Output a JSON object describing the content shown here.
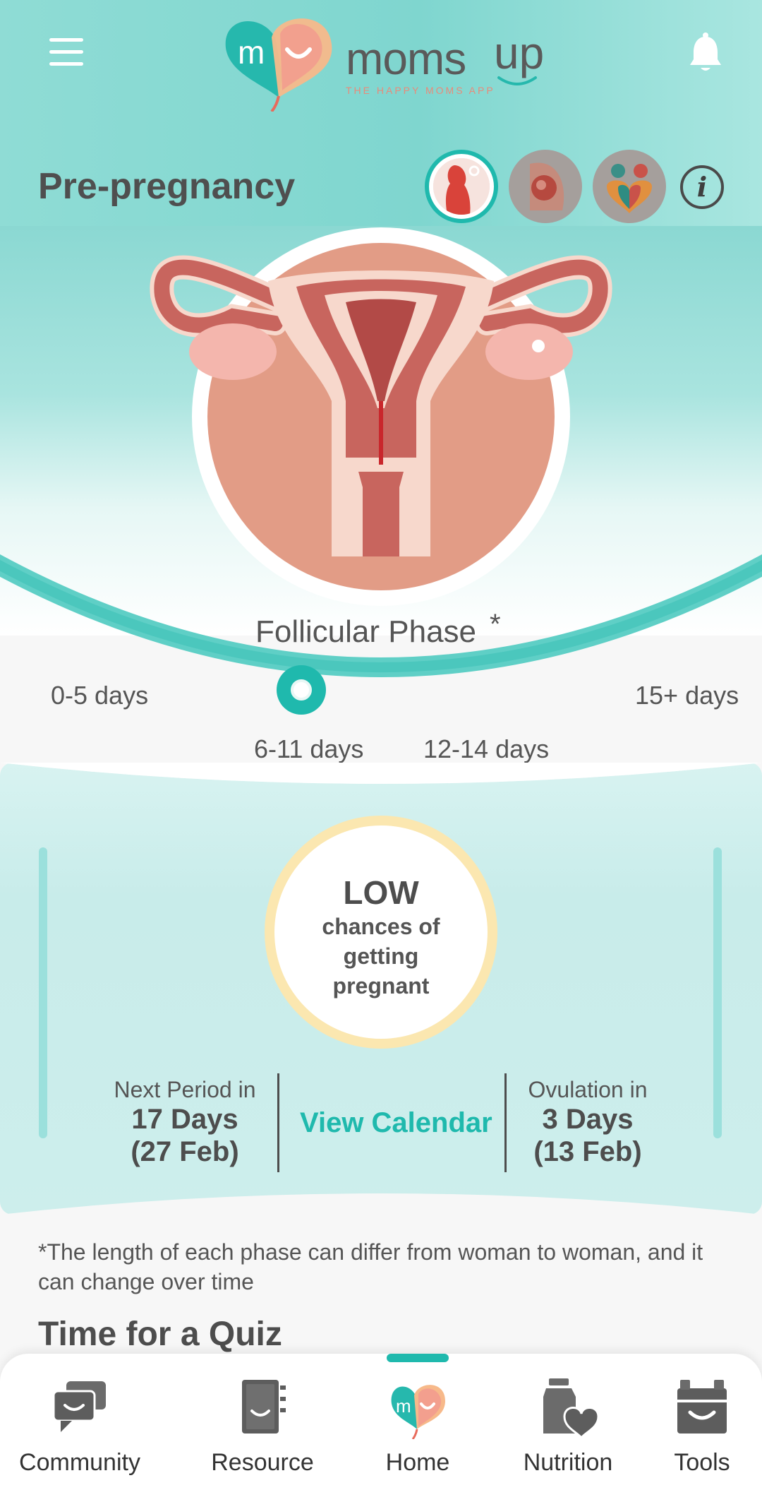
{
  "header": {
    "logo_word": "moms",
    "logo_up": "up",
    "logo_tagline": "THE HAPPY MOMS APP"
  },
  "stage": {
    "title": "Pre-pregnancy",
    "info_label": "i"
  },
  "phase": {
    "name": "Follicular Phase",
    "footnote_mark": "*",
    "ranges": [
      "0-5 days",
      "6-11 days",
      "12-14 days",
      "15+ days"
    ],
    "selected_index": 1
  },
  "fertility": {
    "level": "LOW",
    "description": "chances of getting pregnant"
  },
  "next_period": {
    "label": "Next Period in",
    "days": "17 Days",
    "date": "(27 Feb)"
  },
  "calendar_link": "View Calendar",
  "ovulation": {
    "label": "Ovulation in",
    "days": "3 Days",
    "date": "(13 Feb)"
  },
  "footnote": "*The length of each phase can differ from woman to woman, and it can change over time",
  "quiz_title": "Time for a Quiz",
  "nav": {
    "items": [
      {
        "label": "Community",
        "icon": "community-icon"
      },
      {
        "label": "Resource",
        "icon": "resource-icon"
      },
      {
        "label": "Home",
        "icon": "home-logo-icon"
      },
      {
        "label": "Nutrition",
        "icon": "nutrition-icon"
      },
      {
        "label": "Tools",
        "icon": "tools-icon"
      }
    ],
    "active_index": 2
  },
  "colors": {
    "accent": "#1fb9ad",
    "header_bg": "#8fdcd5",
    "card_bg": "#cdeeec",
    "ring": "#fbe7b0",
    "text_dark": "#4d4d4d"
  }
}
